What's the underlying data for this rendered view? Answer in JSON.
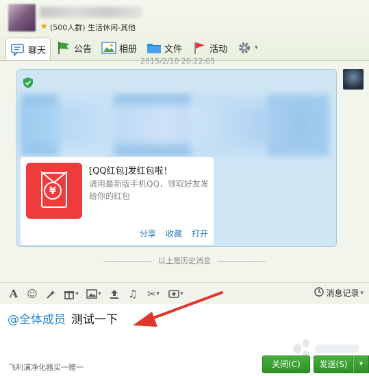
{
  "header": {
    "group_subtitle": "(500人群) 生活休闲-其他"
  },
  "toolbar": {
    "tabs": [
      {
        "label": "聊天",
        "icon": "chat-bubble-icon"
      },
      {
        "label": "公告",
        "icon": "flag-icon"
      },
      {
        "label": "相册",
        "icon": "photo-icon"
      },
      {
        "label": "文件",
        "icon": "folder-icon"
      },
      {
        "label": "活动",
        "icon": "pennant-icon"
      }
    ],
    "settings_icon": "gear-icon"
  },
  "chat": {
    "timestamp": "2015/2/10 20:22:05",
    "red_packet": {
      "title": "[QQ红包]发红包啦！",
      "description": "请用最新版手机QQ，领取好友发给你的红包",
      "actions": [
        "分享",
        "收藏",
        "打开"
      ]
    },
    "history_divider": "以上是历史消息"
  },
  "input_toolbar": {
    "icons": [
      "font-icon",
      "emoji-icon",
      "magic-wand-icon",
      "gift-icon",
      "image-icon",
      "upload-icon",
      "music-icon",
      "screenshot-icon",
      "red-packet-icon"
    ],
    "history_label": "消息记录"
  },
  "input": {
    "mention": "@全体成员",
    "text": "测试一下",
    "ad": "飞利浦净化器买一赠一"
  },
  "buttons": {
    "close": "关闭(C)",
    "send": "发送(S)"
  },
  "colors": {
    "accent_green": "#3aa033",
    "bubble_blue": "#cfe6f5",
    "mention_blue": "#1f86d6",
    "arrow_red": "#e0362c"
  }
}
